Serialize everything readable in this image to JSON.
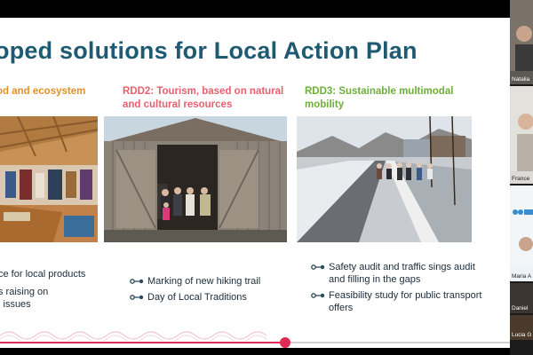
{
  "slide": {
    "title": "oped solutions for Local Action Plan",
    "columns": [
      {
        "heading": "od and ecosystem",
        "bullets": [
          "ce for local products",
          "s raising on",
          "l issues"
        ]
      },
      {
        "heading": "RDD2: Tourism, based on natural and cultural resources",
        "bullets": [
          "Marking of new hiking trail",
          "Day of Local Traditions"
        ]
      },
      {
        "heading": "RDD3: Sustainable multimodal mobility",
        "bullets": [
          "Safety audit and traffic sings audit and filling in the gaps",
          "Feasibility study for public transport offers"
        ]
      }
    ],
    "progress": 0.56
  },
  "participants": [
    {
      "name": "Natalia"
    },
    {
      "name": "France"
    },
    {
      "name": "Maria A"
    },
    {
      "name": "Daniel"
    },
    {
      "name": "Lucia G"
    }
  ],
  "colors": {
    "title": "#1f5a73",
    "heading1": "#e39126",
    "heading2": "#e8606e",
    "heading3": "#6fae3a",
    "progress": "#e02a56"
  }
}
